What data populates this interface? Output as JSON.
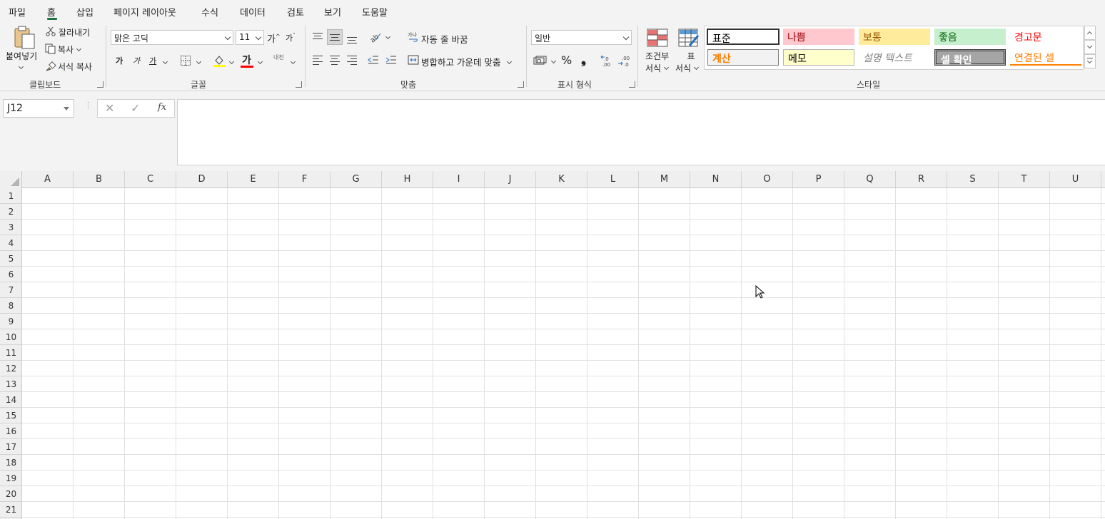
{
  "tabs": [
    "파일",
    "홈",
    "삽입",
    "페이지 레이아웃",
    "수식",
    "데이터",
    "검토",
    "보기",
    "도움말"
  ],
  "active_tab": "홈",
  "clipboard": {
    "paste": "붙여넣기",
    "cut": "잘라내기",
    "copy": "복사",
    "format_painter": "서식 복사",
    "group_label": "클립보드"
  },
  "font": {
    "name": "맑은 고딕",
    "size": "11",
    "increase": "가",
    "decrease": "가",
    "bold": "가",
    "italic": "가",
    "underline": "가",
    "font_color_glyph": "가",
    "phonetic": "내천",
    "group_label": "글꼴",
    "highlight_color": "#ffff00",
    "font_color": "#ff0000"
  },
  "alignment": {
    "wrap_text": "자동 줄 바꿈",
    "merge_center": "병합하고 가운데 맞춤",
    "group_label": "맞춤"
  },
  "number": {
    "format": "일반",
    "percent": "%",
    "comma": "❟",
    "group_label": "표시 형식"
  },
  "styles": {
    "conditional": [
      "조건부",
      "서식"
    ],
    "table": [
      "표",
      "서식"
    ],
    "group_label": "스타일",
    "cells": [
      {
        "label": "표준"
      },
      {
        "label": "나쁨"
      },
      {
        "label": "보통"
      },
      {
        "label": "좋음"
      },
      {
        "label": "경고문"
      },
      {
        "label": "계산"
      },
      {
        "label": "메모"
      },
      {
        "label": "설명 텍스트"
      },
      {
        "label": "셀 확인"
      },
      {
        "label": "연결된 셀"
      }
    ]
  },
  "formula_bar": {
    "name_box": "J12",
    "fx": "fx",
    "content": ""
  },
  "columns": [
    "A",
    "B",
    "C",
    "D",
    "E",
    "F",
    "G",
    "H",
    "I",
    "J",
    "K",
    "L",
    "M",
    "N",
    "O",
    "P",
    "Q",
    "R",
    "S",
    "T",
    "U"
  ],
  "rows": [
    "1",
    "2",
    "3",
    "4",
    "5",
    "6",
    "7",
    "8",
    "9",
    "10",
    "11",
    "12",
    "13",
    "14",
    "15",
    "16",
    "17",
    "18",
    "19",
    "20",
    "21"
  ]
}
